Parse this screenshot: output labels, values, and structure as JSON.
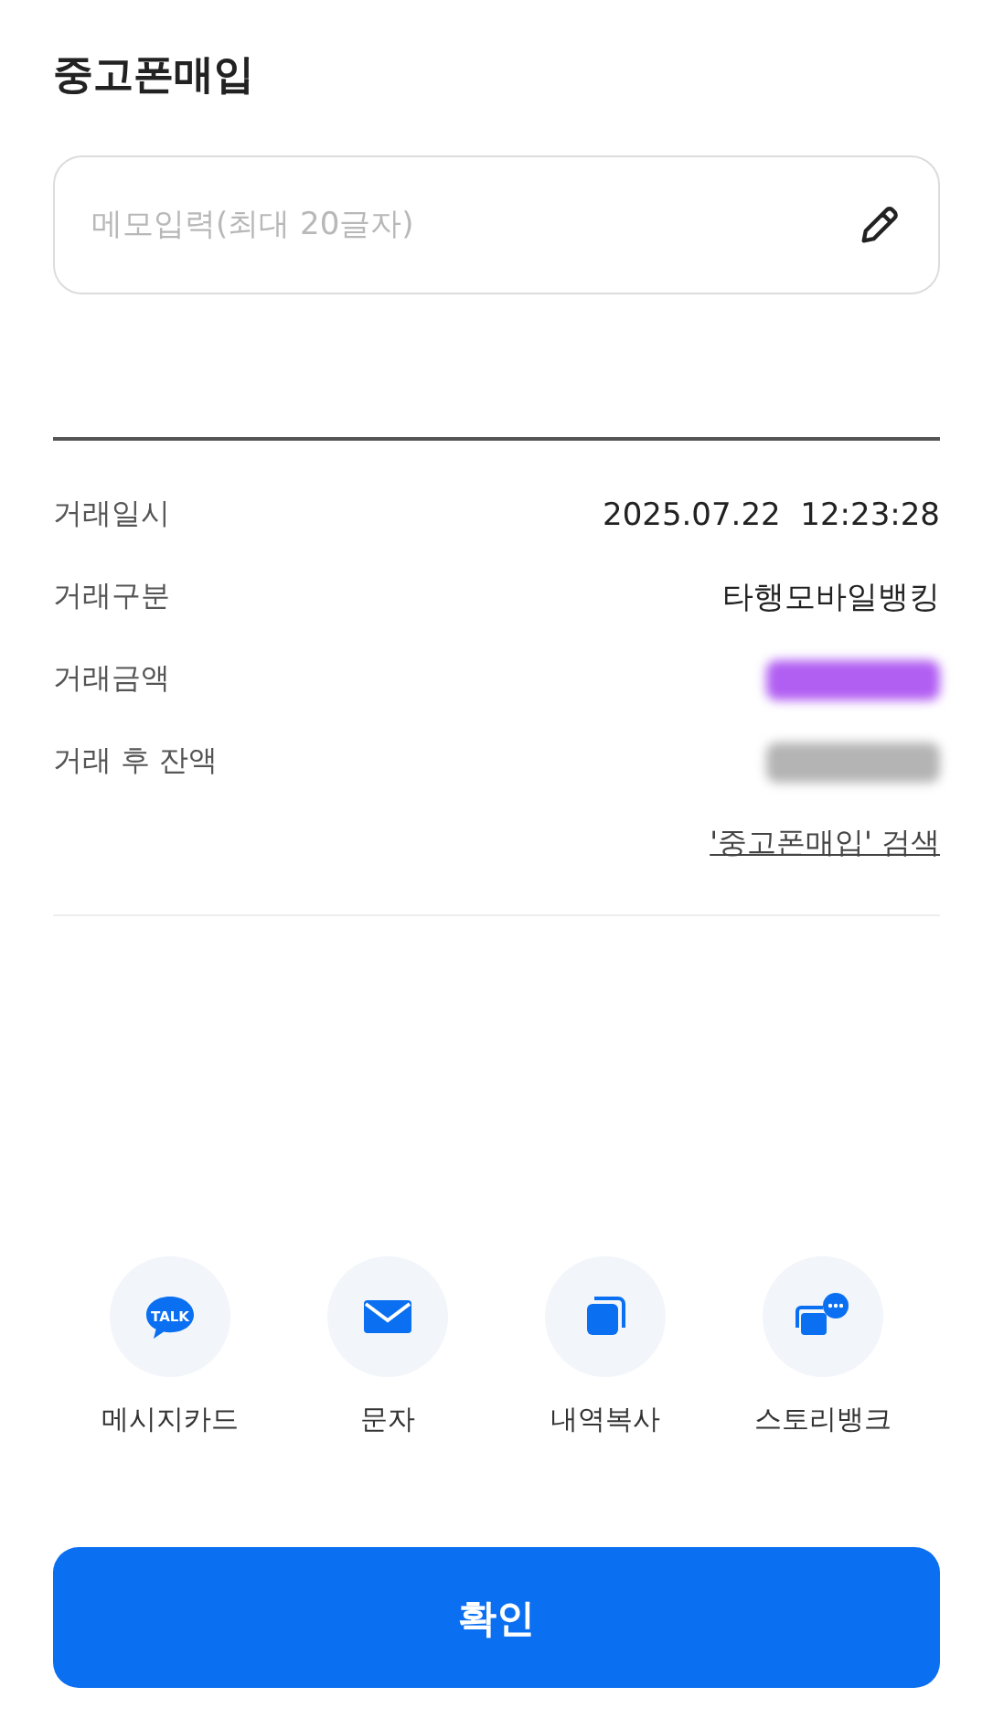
{
  "title": "중고폰매입",
  "memo": {
    "placeholder": "메모입력(최대 20글자)"
  },
  "details": [
    {
      "label": "거래일시",
      "value": "2025.07.22  12:23:28"
    },
    {
      "label": "거래구분",
      "value": "타행모바일뱅킹"
    },
    {
      "label": "거래금액",
      "masked": true,
      "color": "#b15ef2"
    },
    {
      "label": "거래 후 잔액",
      "masked": true,
      "color": "#b4b4b4"
    }
  ],
  "search_link": "'중고폰매입' 검색",
  "share": [
    {
      "kind": "talk",
      "label": "메시지카드",
      "icon_text": "TALK"
    },
    {
      "kind": "mail",
      "label": "문자"
    },
    {
      "kind": "copy",
      "label": "내역복사"
    },
    {
      "kind": "story",
      "label": "스토리뱅크"
    }
  ],
  "confirm_button": "확인"
}
